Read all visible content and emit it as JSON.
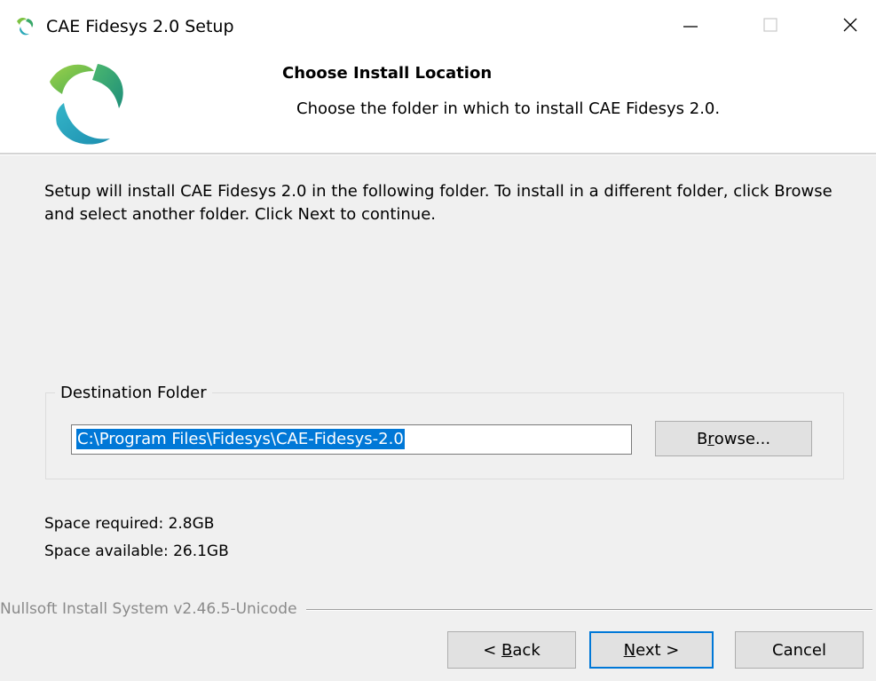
{
  "window": {
    "title": "CAE Fidesys 2.0 Setup",
    "icon": "fidesys-logo-icon",
    "controls": [
      "minimize-icon",
      "maximize-icon",
      "close-icon"
    ]
  },
  "header": {
    "title": "Choose Install Location",
    "subtitle": "Choose the folder in which to install CAE Fidesys 2.0."
  },
  "body": {
    "intro": "Setup will install CAE Fidesys 2.0 in the following folder. To install in a different folder, click Browse and select another folder. Click Next to continue.",
    "destination": {
      "label": "Destination Folder",
      "path": "C:\\Program Files\\Fidesys\\CAE-Fidesys-2.0",
      "browse_prefix": "B",
      "browse_accel": "r",
      "browse_suffix": "owse..."
    },
    "space_required": "Space required: 2.8GB",
    "space_available": "Space available: 26.1GB"
  },
  "footer": {
    "branding": "Nullsoft Install System v2.46.5-Unicode",
    "back_prefix": "< ",
    "back_accel": "B",
    "back_suffix": "ack",
    "next_accel": "N",
    "next_suffix": "ext >",
    "cancel": "Cancel"
  },
  "colors": {
    "accent": "#0078d7",
    "logo_green": "#7cc242",
    "logo_teal": "#2aa8b8"
  }
}
